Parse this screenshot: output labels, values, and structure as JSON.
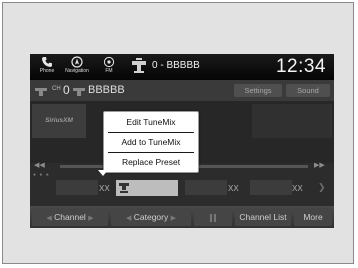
{
  "statusbar": {
    "phone_label": "Phone",
    "navigation_label": "Navigation",
    "fm_label": "FM",
    "source_text": "0 - BBBBB",
    "clock": "12:34"
  },
  "inforow": {
    "channel_prefix": "CH",
    "preset_number": "0",
    "station_name": "BBBBB",
    "settings_label": "Settings",
    "sound_label": "Sound"
  },
  "content": {
    "logo_text": "SiriusXM"
  },
  "presets": {
    "slot1_label": "XX",
    "slot2_label": "XX",
    "slot3_label": "XX",
    "slot4_label": "XX"
  },
  "popup": {
    "items": [
      {
        "label": "Edit TuneMix"
      },
      {
        "label": "Add to TuneMix"
      },
      {
        "label": "Replace Preset"
      }
    ]
  },
  "bottombar": {
    "channel_label": "Channel",
    "category_label": "Category",
    "channel_list_label": "Channel List",
    "more_label": "More"
  }
}
